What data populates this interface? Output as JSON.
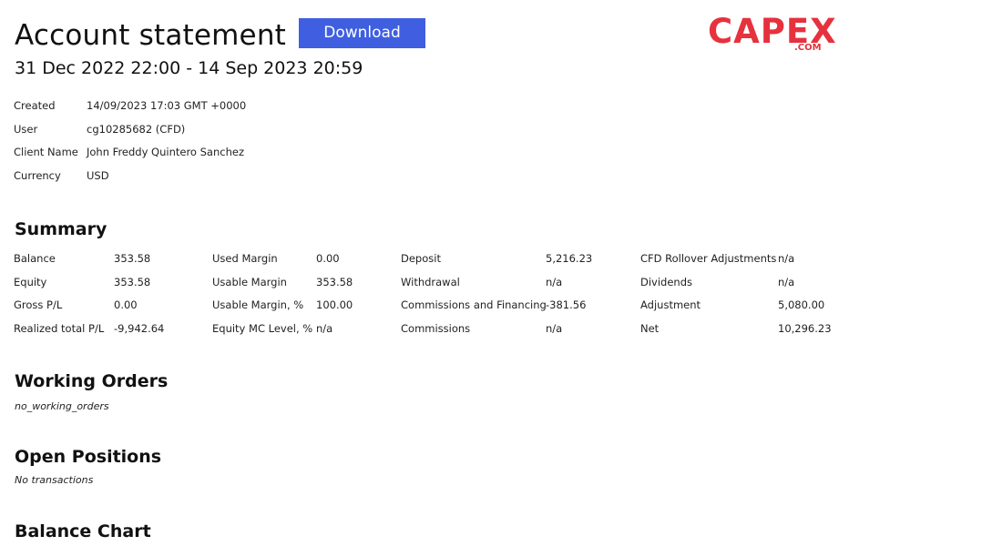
{
  "header": {
    "title": "Account statement",
    "download_label": "Download",
    "period": "31 Dec 2022 22:00 - 14 Sep 2023 20:59"
  },
  "logo": {
    "main": "CAPEX",
    "sub": ".COM",
    "color": "#e6323e"
  },
  "info": [
    {
      "label": "Created",
      "value": "14/09/2023 17:03 GMT +0000"
    },
    {
      "label": "User",
      "value": "cg10285682 (CFD)"
    },
    {
      "label": "Client Name",
      "value": "John Freddy Quintero Sanchez"
    },
    {
      "label": "Currency",
      "value": "USD"
    }
  ],
  "summary": {
    "heading": "Summary",
    "rows": [
      [
        {
          "label": "Balance",
          "value": "353.58"
        },
        {
          "label": "Used Margin",
          "value": "0.00"
        },
        {
          "label": "Deposit",
          "value": "5,216.23"
        },
        {
          "label": "CFD Rollover Adjustments",
          "value": "n/a"
        }
      ],
      [
        {
          "label": "Equity",
          "value": "353.58"
        },
        {
          "label": "Usable Margin",
          "value": "353.58"
        },
        {
          "label": "Withdrawal",
          "value": "n/a"
        },
        {
          "label": "Dividends",
          "value": "n/a"
        }
      ],
      [
        {
          "label": "Gross P/L",
          "value": "0.00"
        },
        {
          "label": "Usable Margin, %",
          "value": "100.00"
        },
        {
          "label": "Commissions and Financing",
          "value": "-381.56"
        },
        {
          "label": "Adjustment",
          "value": "5,080.00"
        }
      ],
      [
        {
          "label": "Realized total P/L",
          "value": "-9,942.64"
        },
        {
          "label": "Equity MC Level, %",
          "value": "n/a"
        },
        {
          "label": "Commissions",
          "value": "n/a"
        },
        {
          "label": "Net",
          "value": "10,296.23"
        }
      ]
    ]
  },
  "working_orders": {
    "heading": "Working Orders",
    "note": "no_working_orders"
  },
  "open_positions": {
    "heading": "Open Positions",
    "note": "No transactions"
  },
  "balance_chart": {
    "heading": "Balance Chart"
  },
  "colors": {
    "button": "#3f5fe0",
    "text": "#111111"
  }
}
